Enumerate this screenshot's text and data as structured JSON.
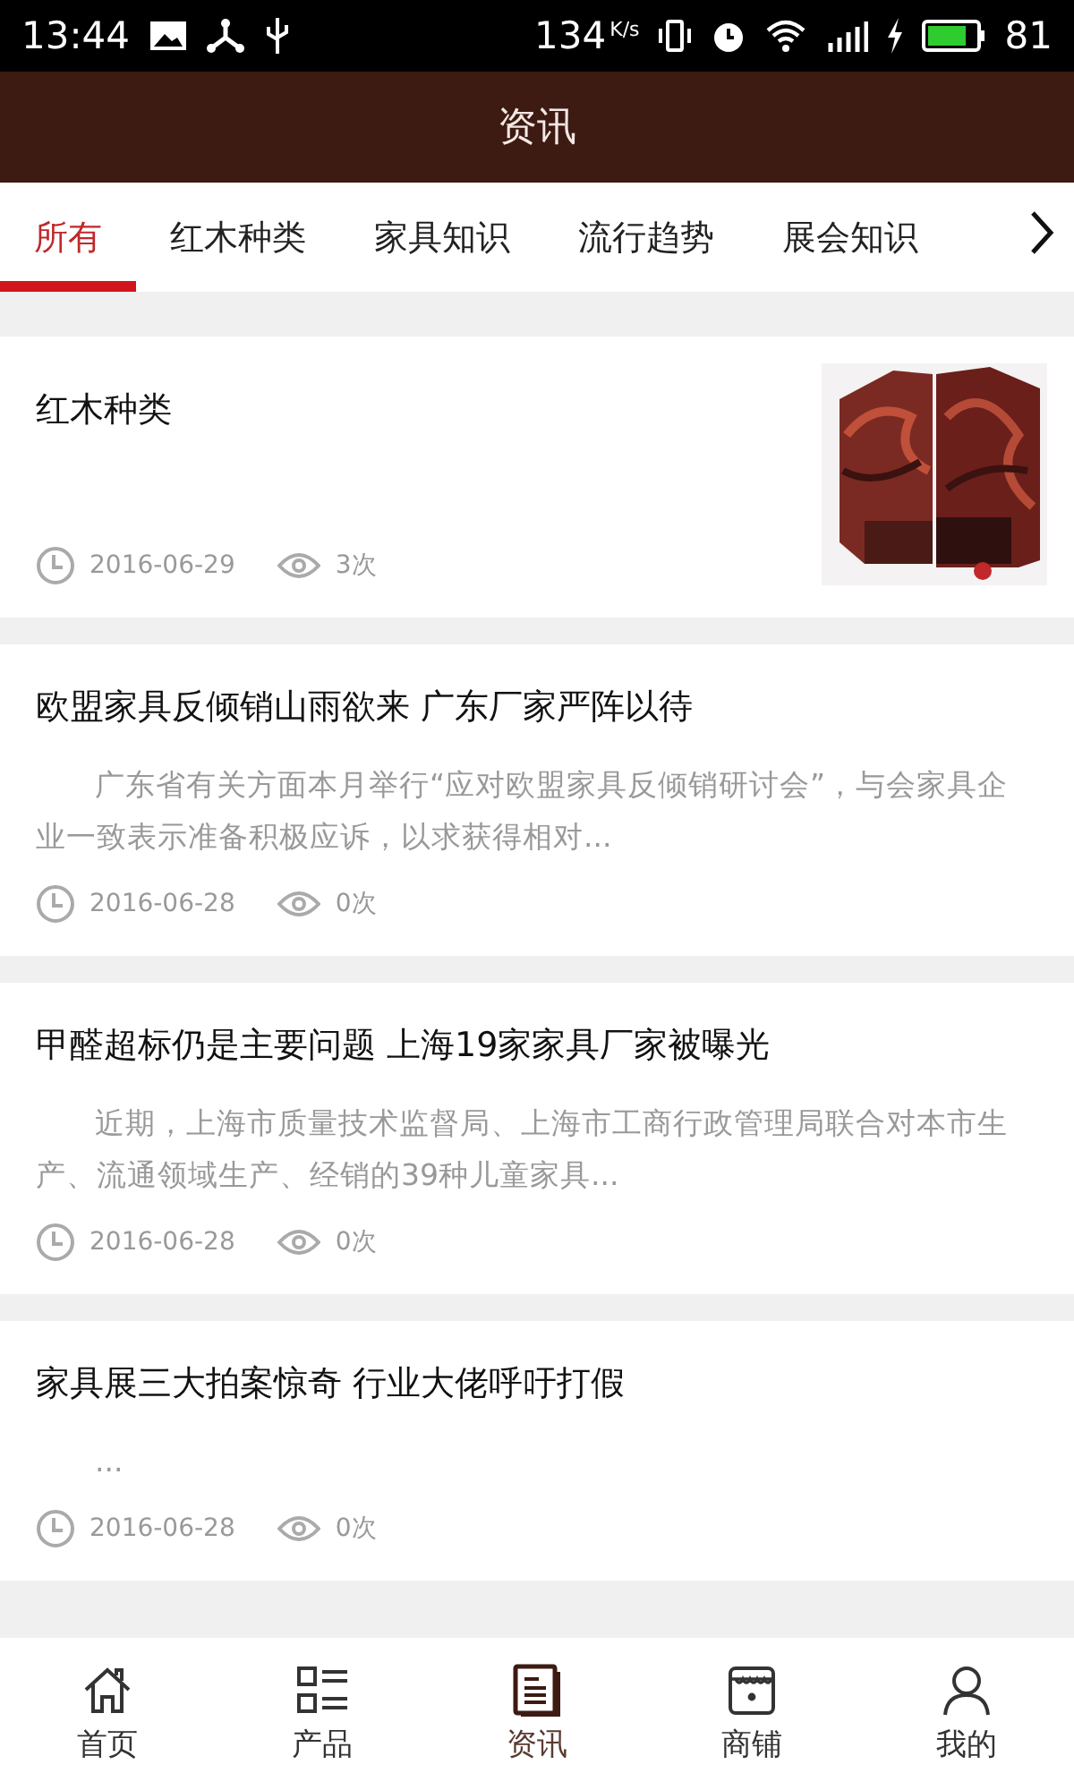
{
  "status_bar": {
    "time": "13:44",
    "speed": "134",
    "speed_unit": "K/s",
    "battery": "81"
  },
  "header": {
    "title": "资讯"
  },
  "tabs": [
    {
      "label": "所有",
      "selected": true
    },
    {
      "label": "红木种类",
      "selected": false
    },
    {
      "label": "家具知识",
      "selected": false
    },
    {
      "label": "流行趋势",
      "selected": false
    },
    {
      "label": "展会知识",
      "selected": false
    }
  ],
  "articles": [
    {
      "title": "红木种类",
      "date": "2016-06-29",
      "views": "3次"
    },
    {
      "title": "欧盟家具反倾销山雨欲来 广东厂家严阵以待",
      "excerpt": "广东省有关方面本月举行“应对欧盟家具反倾销研讨会”，与会家具企业一致表示准备积极应诉，以求获得相对...",
      "date": "2016-06-28",
      "views": "0次"
    },
    {
      "title": "甲醛超标仍是主要问题 上海19家家具厂家被曝光",
      "excerpt": "近期，上海市质量技术监督局、上海市工商行政管理局联合对本市生产、流通领域生产、经销的39种儿童家具...",
      "date": "2016-06-28",
      "views": "0次"
    },
    {
      "title": "家具展三大拍案惊奇 行业大佬呼吁打假",
      "excerpt": "...",
      "date": "2016-06-28",
      "views": "0次"
    }
  ],
  "bottom_nav": [
    {
      "label": "首页",
      "kind": "home",
      "selected": false
    },
    {
      "label": "产品",
      "kind": "list",
      "selected": false
    },
    {
      "label": "资讯",
      "kind": "news",
      "selected": true
    },
    {
      "label": "商铺",
      "kind": "shop",
      "selected": false
    },
    {
      "label": "我的",
      "kind": "user",
      "selected": false
    }
  ]
}
